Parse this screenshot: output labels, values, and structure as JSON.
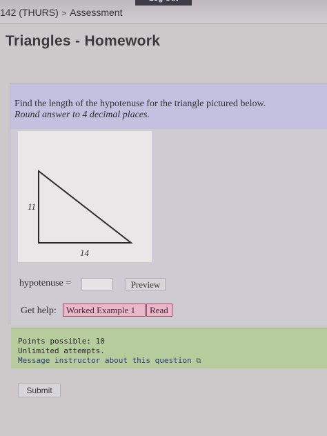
{
  "header": {
    "logout_label": "Log Out",
    "breadcrumb": [
      "142 (THURS)",
      "Assessment"
    ],
    "separator": ">"
  },
  "page_title": "Triangles - Homework",
  "question": {
    "prompt": "Find the length of the hypotenuse for the triangle pictured below.",
    "instruction": "Round answer to 4 decimal places.",
    "figure": {
      "side_vertical": "11",
      "side_horizontal": "14"
    },
    "answer_label": "hypotenuse =",
    "answer_value": "",
    "preview_label": "Preview",
    "help_label": "Get help:",
    "help_links": [
      "Worked Example 1",
      "Read"
    ]
  },
  "info": {
    "points": "Points possible: 10",
    "attempts": "Unlimited attempts.",
    "message_link": "Message instructor about this question"
  },
  "submit_label": "Submit"
}
